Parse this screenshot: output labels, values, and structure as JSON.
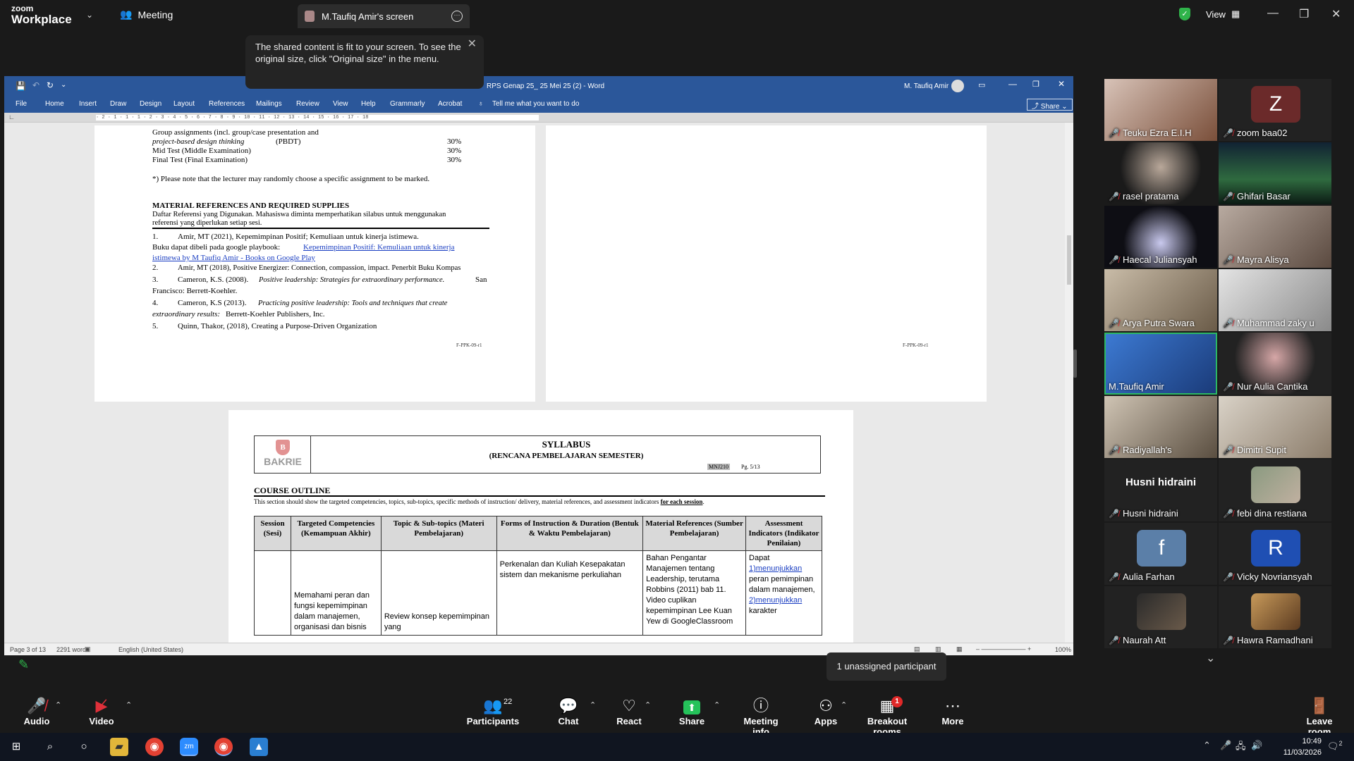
{
  "zoom": {
    "brand_line1": "zoom",
    "brand_line2": "Workplace",
    "meeting_label": "Meeting",
    "shared_tab_label": "M.Taufiq Amir's screen",
    "view_label": "View",
    "tooltip_text": "The shared content is fit to your screen. To see the original size, click \"Original size\" in the menu.",
    "unassigned_text": "1 unassigned participant"
  },
  "word": {
    "title": "RPS Genap 25_ 25 Mei 25 (2)  -  Word",
    "user": "M. Taufiq Amir",
    "share_label": "Share",
    "tabs": [
      "File",
      "Home",
      "Insert",
      "Draw",
      "Design",
      "Layout",
      "References",
      "Mailings",
      "Review",
      "View",
      "Help",
      "Grammarly",
      "Acrobat"
    ],
    "tell_me": "Tell me what you want to do",
    "ruler_text": "· 2 · 1 · 1 · 1 · 2 · 3 · 4 · 5 · 6 · 7 · 8 · 9 · 10 · 11 · 12 · 13 · 14 · 15 · 16 · 17 · 18",
    "status_page": "Page 3 of 13",
    "status_words": "2291 words",
    "status_lang": "English (United States)",
    "status_zoom": "100%"
  },
  "page1": {
    "lines": [
      "Group assignments (incl. group/case presentation and",
      "project-based design thinking",
      "(PBDT)",
      "Mid Test (Middle Examination)",
      "Final Test (Final Examination)",
      "*) Please note that the lecturer may randomly choose a specific assignment to be marked.",
      "MATERIAL REFERENCES AND REQUIRED SUPPLIES",
      "Daftar Referensi yang Digunakan. Mahasiswa diminta memperhatikan silabus untuk menggunakan",
      "referensi yang diperlukan setiap sesi.",
      "1.",
      "Amir, MT (2021), Kepemimpinan Positif; Kemuliaan untuk kinerja istimewa.",
      "Buku dapat dibeli pada google playbook:",
      "Kepemimpinan Positif: Kemuliaan untuk kinerja",
      "istimewa by M Taufiq Amir - Books on Google Play",
      "2.",
      "Amir, MT (2018), Positive Energizer: Connection, compassion, impact. Penerbit Buku Kompas",
      "3.",
      "Cameron, K.S. (2008).",
      "Positive leadership: Strategies for extraordinary performance.",
      "San",
      "Francisco: Berrett-Koehler.",
      "4.",
      "Cameron, K.S (2013).",
      "Practicing positive leadership: Tools and techniques that create",
      "extraordinary results:",
      "Berrett-Koehler Publishers, Inc.",
      "5.",
      "Quinn, Thakor, (2018), Creating a Purpose-Driven Organization"
    ],
    "percents": [
      "30%",
      "30%",
      "30%"
    ],
    "footer": "F-PPK-09-r1"
  },
  "page2": {
    "footer": "F-PPK-09-r1"
  },
  "page3": {
    "logo_text": "BAKRIE",
    "syllabus_title": "SYLLABUS",
    "syllabus_subtitle": "(RENCANA PEMBELAJARAN SEMESTER)",
    "code": "MNJ210",
    "page_ref": "Pg. 5/13",
    "outline_title": "COURSE OUTLINE",
    "outline_desc": "This section should show the targeted competencies, topics, sub-topics, specific methods of instruction/ delivery, material references, and assessment indicators",
    "outline_desc_bold": "for each session",
    "headers": [
      "Session (Sesi)",
      "Targeted Competencies (Kemampuan Akhir)",
      "Topic & Sub-topics (Materi Pembelajaran)",
      "Forms of Instruction & Duration (Bentuk & Waktu Pembelajaran)",
      "Material References (Sumber Pembelajaran)",
      "Assessment Indicators (Indikator Penilaian)"
    ],
    "row1": {
      "session": "",
      "competency": "Memahami peran dan fungsi kepemimpinan dalam manajemen, organisasi dan bisnis",
      "topic": "Review konsep kepemimpinan yang",
      "instruction": "Perkenalan dan Kuliah Kesepakatan sistem dan mekanisme perkuliahan",
      "reference": "Bahan Pengantar Manajemen tentang Leadership, terutama Robbins (2011) bab 11. Video cuplikan kepemimpinan Lee Kuan Yew di GoogleClassroom",
      "assessment_pre": "Dapat",
      "assessment_link1": "1)menunjukkan",
      "assessment_mid": "peran pemimpinan dalam manajemen,",
      "assessment_link2": "2)menunjukkan",
      "assessment_post": "karakter"
    }
  },
  "participants": [
    {
      "name": "Teuku Ezra E.I.H",
      "muted": true
    },
    {
      "name": "zoom baa02",
      "muted": true,
      "initial": "Z",
      "color": "#6b2a2a"
    },
    {
      "name": "rasel pratama",
      "muted": true
    },
    {
      "name": "Ghifari Basar",
      "muted": true
    },
    {
      "name": "Haecal Juliansyah",
      "muted": true
    },
    {
      "name": "Mayra Alisya",
      "muted": true
    },
    {
      "name": "Arya Putra Swara",
      "muted": true
    },
    {
      "name": "Muhammad zaky u",
      "muted": true
    },
    {
      "name": "M.Taufiq Amir",
      "muted": false
    },
    {
      "name": "Nur Aulia Cantika",
      "muted": true
    },
    {
      "name": "Radiyallah's",
      "muted": true
    },
    {
      "name": "Dimitri Supit",
      "muted": true
    },
    {
      "name": "Husni hidraini",
      "muted": true,
      "big_name": "Husni hidraini"
    },
    {
      "name": "febi dina restiana",
      "muted": true
    },
    {
      "name": "Aulia Farhan",
      "muted": true,
      "initial": "f",
      "color": "#5b7fa8"
    },
    {
      "name": "Vicky Novriansyah",
      "muted": true,
      "initial": "R",
      "color": "#1f4fb3"
    },
    {
      "name": "Naurah Att",
      "muted": true
    },
    {
      "name": "Hawra Ramadhani",
      "muted": true
    }
  ],
  "toolbar": {
    "audio": "Audio",
    "video": "Video",
    "participants": "Participants",
    "participants_count": "22",
    "chat": "Chat",
    "react": "React",
    "share": "Share",
    "meeting_info": "Meeting info",
    "apps": "Apps",
    "breakout": "Breakout rooms",
    "breakout_badge": "1",
    "more": "More",
    "leave": "Leave room"
  },
  "taskbar": {
    "time": "10:49",
    "date": "11/03/2026",
    "notif_count": "2"
  }
}
